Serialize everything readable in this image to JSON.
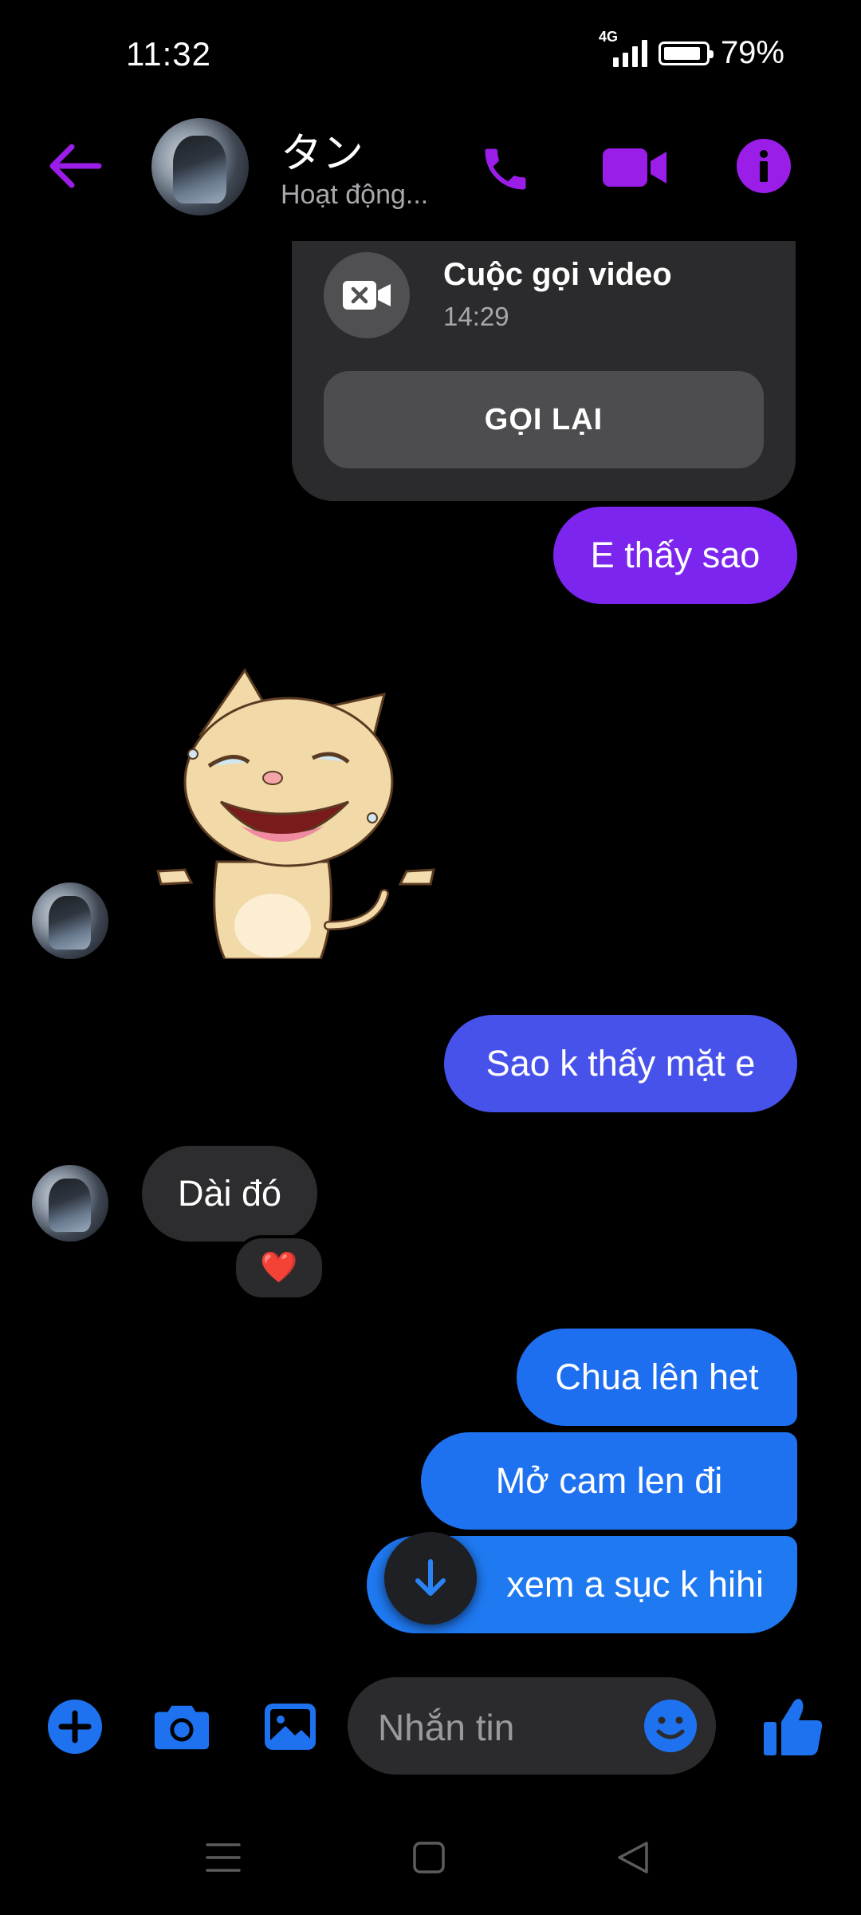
{
  "status_bar": {
    "time": "11:32",
    "network": "4G",
    "battery": "79%"
  },
  "header": {
    "name": "タン",
    "status": "Hoạt động..."
  },
  "call_card": {
    "title": "Cuộc gọi video",
    "time": "14:29",
    "button": "GỌI LẠI"
  },
  "messages": [
    {
      "text": "E thấy sao"
    },
    {
      "text": "Sao k thấy mặt e"
    },
    {
      "text": "Dài đó",
      "reaction": "❤️"
    },
    {
      "text": "Chua lên het"
    },
    {
      "text": "Mở cam len đi"
    },
    {
      "text": "xem a sục k hihi"
    }
  ],
  "composer": {
    "placeholder": "Nhắn tin"
  },
  "colors": {
    "accent": "#9a1de8",
    "blue": "#1e72f0",
    "bubble_gray": "#2d2d2f"
  }
}
